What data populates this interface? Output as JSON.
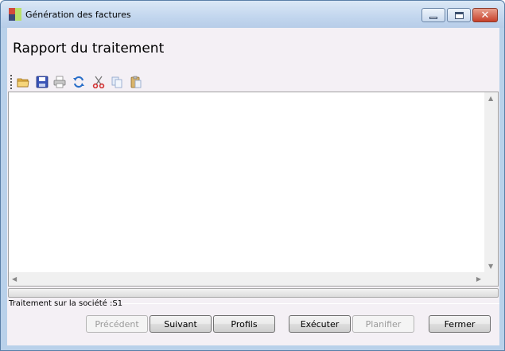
{
  "window": {
    "title": "Génération des factures"
  },
  "page": {
    "title": "Rapport du traitement"
  },
  "toolbar": {
    "icons": [
      "open-folder-icon",
      "save-icon",
      "print-icon",
      "refresh-icon",
      "cut-icon",
      "copy-icon",
      "paste-icon"
    ]
  },
  "report": {
    "content": ""
  },
  "progress": {
    "value": 0
  },
  "status": {
    "text": "Traitement sur la société :S1"
  },
  "buttons": {
    "previous": "Précédent",
    "next": "Suivant",
    "profiles": "Profils",
    "execute": "Exécuter",
    "schedule": "Planifier",
    "close": "Fermer"
  }
}
